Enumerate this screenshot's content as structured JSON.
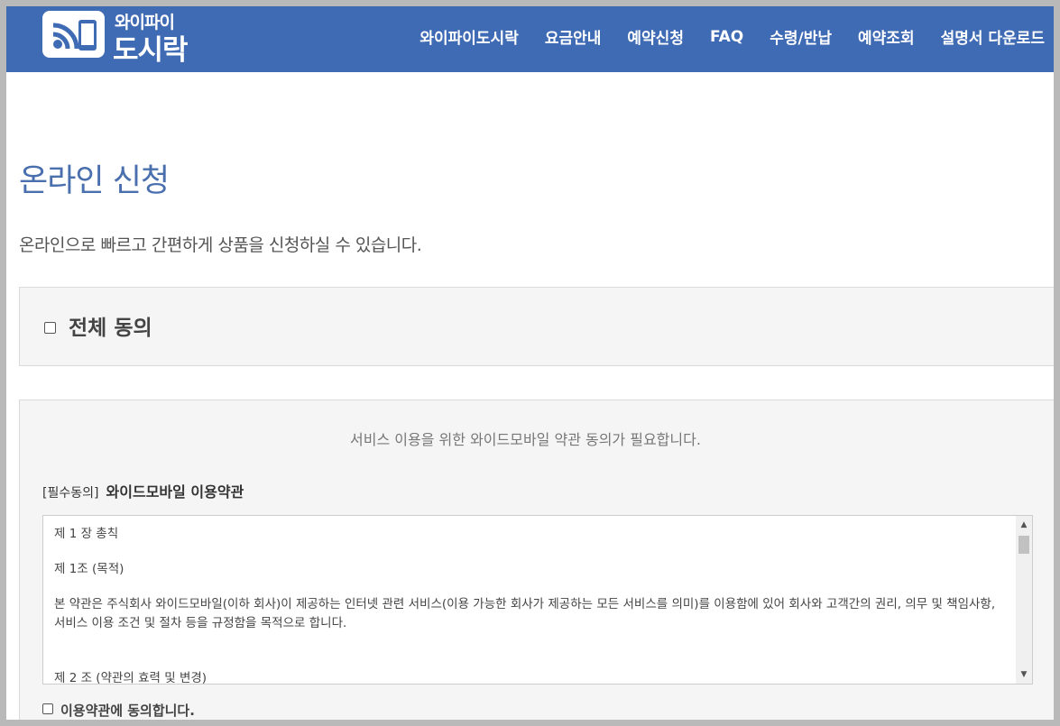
{
  "logo": {
    "line1": "와이파이",
    "line2": "도시락"
  },
  "nav": {
    "items": [
      "와이파이도시락",
      "요금안내",
      "예약신청",
      "FAQ",
      "수령/반납",
      "예약조회",
      "설명서 다운로드"
    ]
  },
  "page": {
    "title": "온라인 신청",
    "subtitle": "온라인으로 빠르고 간편하게 상품을 신청하실 수 있습니다."
  },
  "agree_all": {
    "label": "전체 동의",
    "checked": false
  },
  "terms": {
    "notice": "서비스 이용을 위한 와이드모바일 약관 동의가 필요합니다.",
    "required_tag": "[필수동의]",
    "title": "와이드모바일 이용약관",
    "paragraphs": [
      "제 1 장 총칙",
      "제 1조 (목적)",
      "본 약관은 주식회사 와이드모바일(이하 회사)이 제공하는 인터넷 관련 서비스(이용 가능한 회사가 제공하는 모든 서비스를 의미)를 이용함에 있어 회사와 고객간의 권리, 의무 및 책임사항, 서비스 이용 조건 및 절차 등을 규정함을 목적으로 합니다.",
      "제 2 조 (약관의 효력 및 변경)"
    ],
    "agree_label": "이용약관에 동의합니다.",
    "agree_checked": false
  },
  "colors": {
    "header_bg": "#3f6bb5",
    "title": "#4a6fae"
  }
}
